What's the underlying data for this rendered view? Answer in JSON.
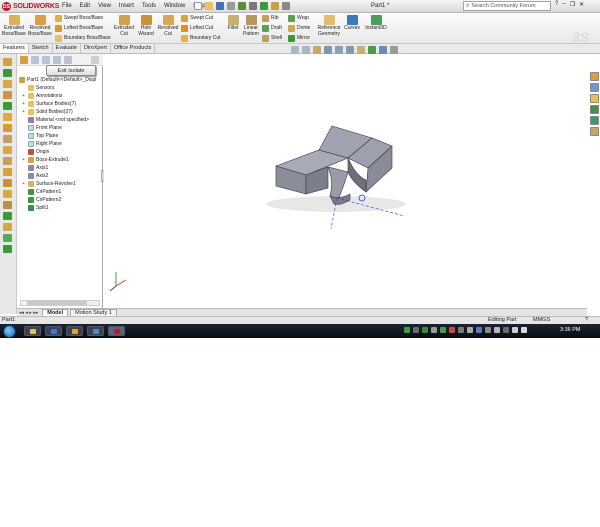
{
  "app": {
    "logo_text": "SOLIDWORKS",
    "logo_mark": "DS",
    "menu": [
      "File",
      "Edit",
      "View",
      "Insert",
      "Tools",
      "Window",
      "Help"
    ],
    "document_title": "Part1 *",
    "search_placeholder": "Search Community Forum",
    "watermark": "3S"
  },
  "commands": {
    "extruded_boss": "Extruded Boss/Base",
    "revolved_boss": "Revolved Boss/Base",
    "swept_boss": "Swept Boss/Base",
    "lofted_boss": "Lofted Boss/Base",
    "boundary_boss": "Boundary Boss/Base",
    "extruded_cut": "Extruded Cut",
    "hole_wizard": "Hole Wizard",
    "revolved_cut": "Revolved Cut",
    "swept_cut": "Swept Cut",
    "lofted_cut": "Lofted Cut",
    "boundary_cut": "Boundary Cut",
    "fillet": "Fillet",
    "linear_pattern": "Linear Pattern",
    "rib": "Rib",
    "draft": "Draft",
    "shell": "Shell",
    "wrap": "Wrap",
    "dome": "Dome",
    "mirror": "Mirror",
    "reference_geometry": "Reference Geometry",
    "curves": "Curves",
    "instant3d": "Instant3D"
  },
  "tabs": [
    "Features",
    "Sketch",
    "Evaluate",
    "DimXpert",
    "Office Products"
  ],
  "feature_manager": {
    "exit_isolate": "Exit Isolate",
    "root": "Part1 (Default<<Default>_Displ",
    "items": [
      {
        "label": "Sensors",
        "expand": ""
      },
      {
        "label": "Annotations",
        "expand": "+"
      },
      {
        "label": "Surface Bodies(7)",
        "expand": "+"
      },
      {
        "label": "Solid Bodies(27)",
        "expand": "+"
      },
      {
        "label": "Material <not specified>",
        "expand": ""
      },
      {
        "label": "Front Plane",
        "expand": ""
      },
      {
        "label": "Top Plane",
        "expand": ""
      },
      {
        "label": "Right Plane",
        "expand": ""
      },
      {
        "label": "Origin",
        "expand": ""
      },
      {
        "label": "Boss-Extrude1",
        "expand": "+"
      },
      {
        "label": "Axis1",
        "expand": ""
      },
      {
        "label": "Axis2",
        "expand": ""
      },
      {
        "label": "Surface-Revolve1",
        "expand": "+"
      },
      {
        "label": "CirPattern1",
        "expand": ""
      },
      {
        "label": "CirPattern2",
        "expand": ""
      },
      {
        "label": "Split1",
        "expand": ""
      }
    ]
  },
  "bottom_tabs": [
    "Model",
    "Motion Study 1"
  ],
  "status": {
    "left": "Part1",
    "mode": "Editing Part",
    "units": "MMGS"
  },
  "taskbar": {
    "clock": "3:36 PM"
  }
}
